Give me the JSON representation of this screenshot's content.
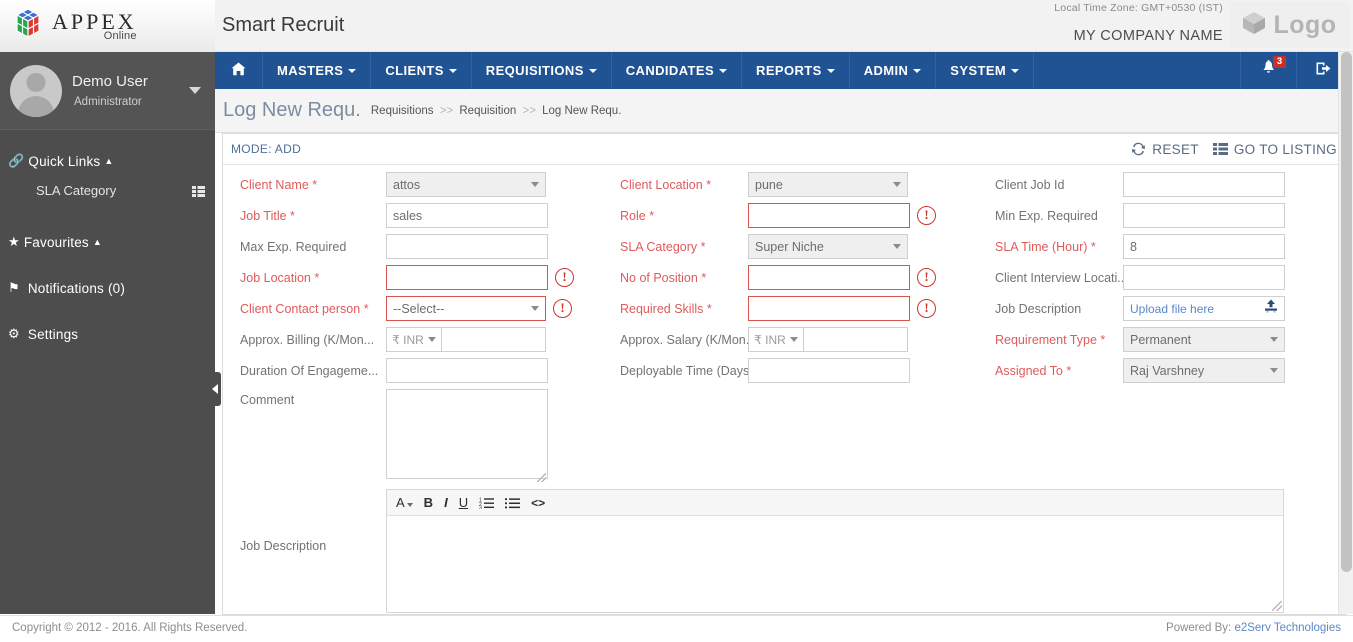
{
  "brand": {
    "name": "APPEX",
    "sub": "Online",
    "app_title": "Smart Recruit",
    "logo_right_text": "Logo",
    "logo_right_icon": "cube-icon"
  },
  "header": {
    "timezone": "Local Time Zone: GMT+0530 (IST)",
    "company": "MY COMPANY NAME"
  },
  "sidebar": {
    "user": {
      "name": "Demo User",
      "role": "Administrator",
      "caret_icon": "chevron-down-icon"
    },
    "sections": [
      {
        "label": "Quick Links",
        "icon": "link-icon",
        "caret": "caret-up-icon"
      },
      {
        "label": "Favourites",
        "icon": "star-icon",
        "caret": "caret-up-icon"
      },
      {
        "label": "Notifications (0)",
        "icon": "flag-icon",
        "caret": ""
      },
      {
        "label": "Settings",
        "icon": "gears-icon",
        "caret": ""
      }
    ],
    "quick_link_items": [
      {
        "label": "SLA Category",
        "icon": "grid-list-icon"
      }
    ]
  },
  "navbar": {
    "home_icon": "home-icon",
    "items": [
      {
        "label": "MASTERS",
        "caret": "caret-down-icon"
      },
      {
        "label": "CLIENTS",
        "caret": "caret-down-icon"
      },
      {
        "label": "REQUISITIONS",
        "caret": "caret-down-icon"
      },
      {
        "label": "CANDIDATES",
        "caret": "caret-down-icon"
      },
      {
        "label": "REPORTS",
        "caret": "caret-down-icon"
      },
      {
        "label": "ADMIN",
        "caret": "caret-down-icon"
      },
      {
        "label": "SYSTEM",
        "caret": "caret-down-icon"
      }
    ],
    "notifications": {
      "icon": "bell-icon",
      "count": "3"
    },
    "logout": {
      "icon": "logout-icon"
    },
    "accent_color": "#1f5394",
    "badge_color": "#c9302c"
  },
  "pagehead": {
    "title": "Log New Requ.",
    "breadcrumb": [
      "Requisitions",
      "Requisition",
      "Log New Requ."
    ],
    "separator": ">>"
  },
  "panel": {
    "mode": "MODE: ADD",
    "actions": [
      {
        "label": "RESET",
        "icon": "refresh-icon"
      },
      {
        "label": "GO TO LISTING",
        "icon": "list-icon"
      }
    ]
  },
  "form": {
    "col1": [
      {
        "label": "Client Name",
        "required": true,
        "type": "select",
        "value": "attos",
        "error": false
      },
      {
        "label": "Job Title",
        "required": true,
        "type": "text",
        "value": "sales",
        "error": false
      },
      {
        "label": "Max Exp. Required",
        "required": false,
        "type": "text",
        "value": "",
        "error": false
      },
      {
        "label": "Job Location",
        "required": true,
        "type": "text",
        "value": "",
        "error": true
      },
      {
        "label": "Client Contact person",
        "required": true,
        "type": "select",
        "value": "--Select--",
        "error": true
      },
      {
        "label": "Approx. Billing (K/Mon...",
        "required": false,
        "type": "currency",
        "currency": "₹ INR",
        "value": "",
        "error": false
      },
      {
        "label": "Duration Of Engageme...",
        "required": false,
        "type": "text",
        "value": "",
        "error": false
      },
      {
        "label": "Comment",
        "required": false,
        "type": "textarea",
        "value": "",
        "error": false
      }
    ],
    "col2": [
      {
        "label": "Client Location",
        "required": true,
        "type": "select",
        "value": "pune",
        "error": false
      },
      {
        "label": "Role",
        "required": true,
        "type": "text",
        "value": "",
        "error": true
      },
      {
        "label": "SLA Category",
        "required": true,
        "type": "select",
        "value": "Super Niche",
        "error": false
      },
      {
        "label": "No of Position",
        "required": true,
        "type": "text",
        "value": "",
        "error": true
      },
      {
        "label": "Required Skills",
        "required": true,
        "type": "text",
        "value": "",
        "error": true
      },
      {
        "label": "Approx. Salary (K/Mon...",
        "required": false,
        "type": "currency",
        "currency": "₹ INR",
        "value": "",
        "error": false
      },
      {
        "label": "Deployable Time (Days)",
        "required": false,
        "type": "text",
        "value": "",
        "error": false
      }
    ],
    "col3": [
      {
        "label": "Client Job Id",
        "required": false,
        "type": "text",
        "value": "",
        "error": false
      },
      {
        "label": "Min Exp. Required",
        "required": false,
        "type": "text",
        "value": "",
        "error": false
      },
      {
        "label": "SLA Time (Hour)",
        "required": true,
        "type": "readonly",
        "value": "8",
        "error": false
      },
      {
        "label": "Client Interview Locati...",
        "required": false,
        "type": "text",
        "value": "",
        "error": false
      },
      {
        "label": "Job Description",
        "required": false,
        "type": "upload",
        "placeholder": "Upload file here",
        "upload_icon": "upload-icon",
        "error": false
      },
      {
        "label": "Requirement Type",
        "required": true,
        "type": "select",
        "value": "Permanent",
        "error": false
      },
      {
        "label": "Assigned To",
        "required": true,
        "type": "select",
        "value": "Raj Varshney",
        "error": false
      }
    ],
    "required_marker": "*",
    "error_icon": "exclamation-circle-icon",
    "required_color": "#de5b5b",
    "error_color": "#d0342c"
  },
  "editor": {
    "label": "Job Description",
    "value": "",
    "toolbar": [
      {
        "name": "font-color-icon",
        "glyph": "A"
      },
      {
        "name": "bold-icon",
        "glyph": "B"
      },
      {
        "name": "italic-icon",
        "glyph": "I"
      },
      {
        "name": "underline-icon",
        "glyph": "U"
      },
      {
        "name": "ordered-list-icon",
        "glyph": "☰"
      },
      {
        "name": "unordered-list-icon",
        "glyph": "☰"
      },
      {
        "name": "source-code-icon",
        "glyph": "<>"
      }
    ]
  },
  "footer": {
    "copyright": "Copyright © 2012 - 2016. All Rights Reserved.",
    "powered_prefix": "Powered By:",
    "powered_link": "e2Serv Technologies"
  }
}
